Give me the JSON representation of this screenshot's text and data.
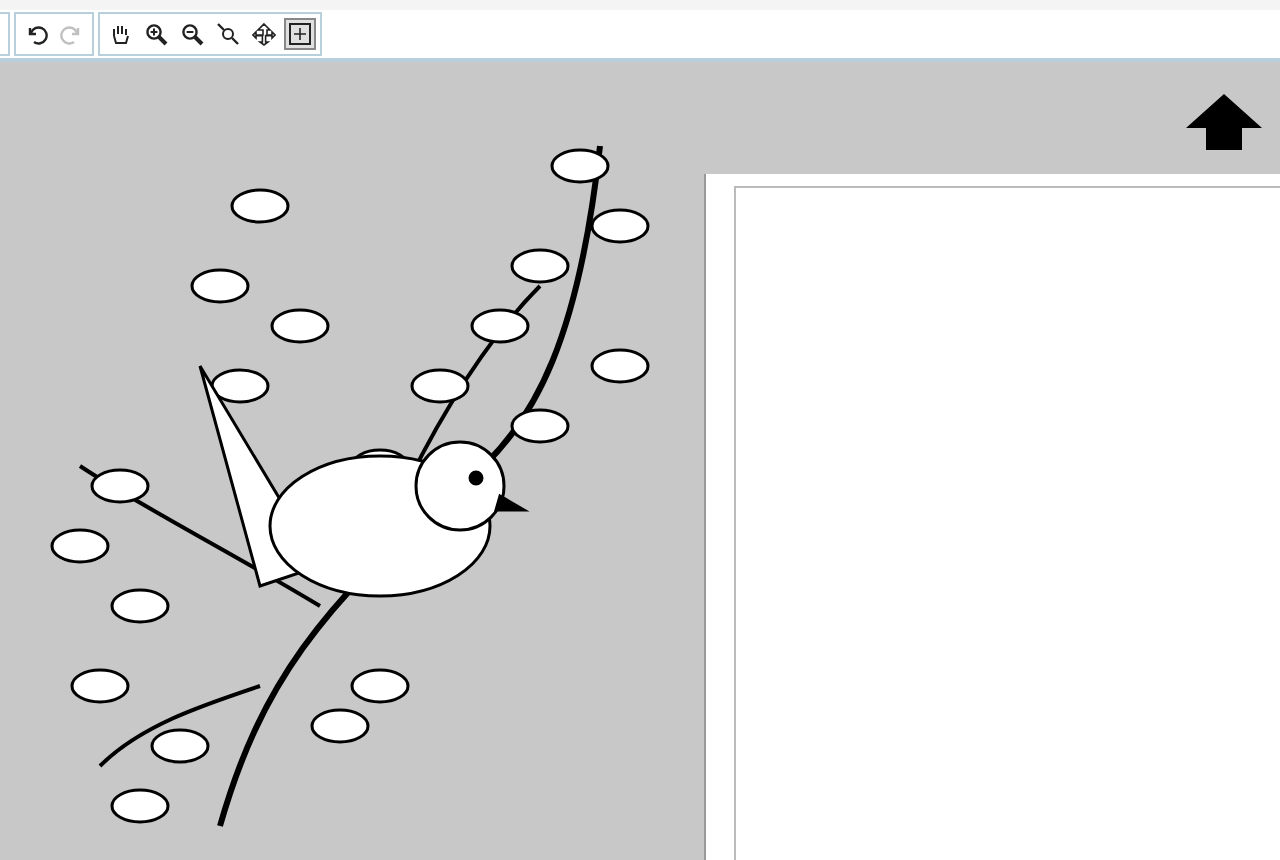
{
  "toolbar": {
    "groups": [
      {
        "tools": [
          {
            "kind": "undo",
            "disabled": false,
            "selected": false
          },
          {
            "kind": "redo",
            "disabled": true,
            "selected": false
          }
        ]
      },
      {
        "tools": [
          {
            "kind": "hand",
            "disabled": false,
            "selected": false
          },
          {
            "kind": "zoom-in",
            "disabled": false,
            "selected": false
          },
          {
            "kind": "zoom-out",
            "disabled": false,
            "selected": false
          },
          {
            "kind": "zoom-area",
            "disabled": false,
            "selected": false
          },
          {
            "kind": "pan-arrows",
            "disabled": false,
            "selected": false
          },
          {
            "kind": "fit",
            "disabled": false,
            "selected": true
          }
        ]
      }
    ]
  }
}
